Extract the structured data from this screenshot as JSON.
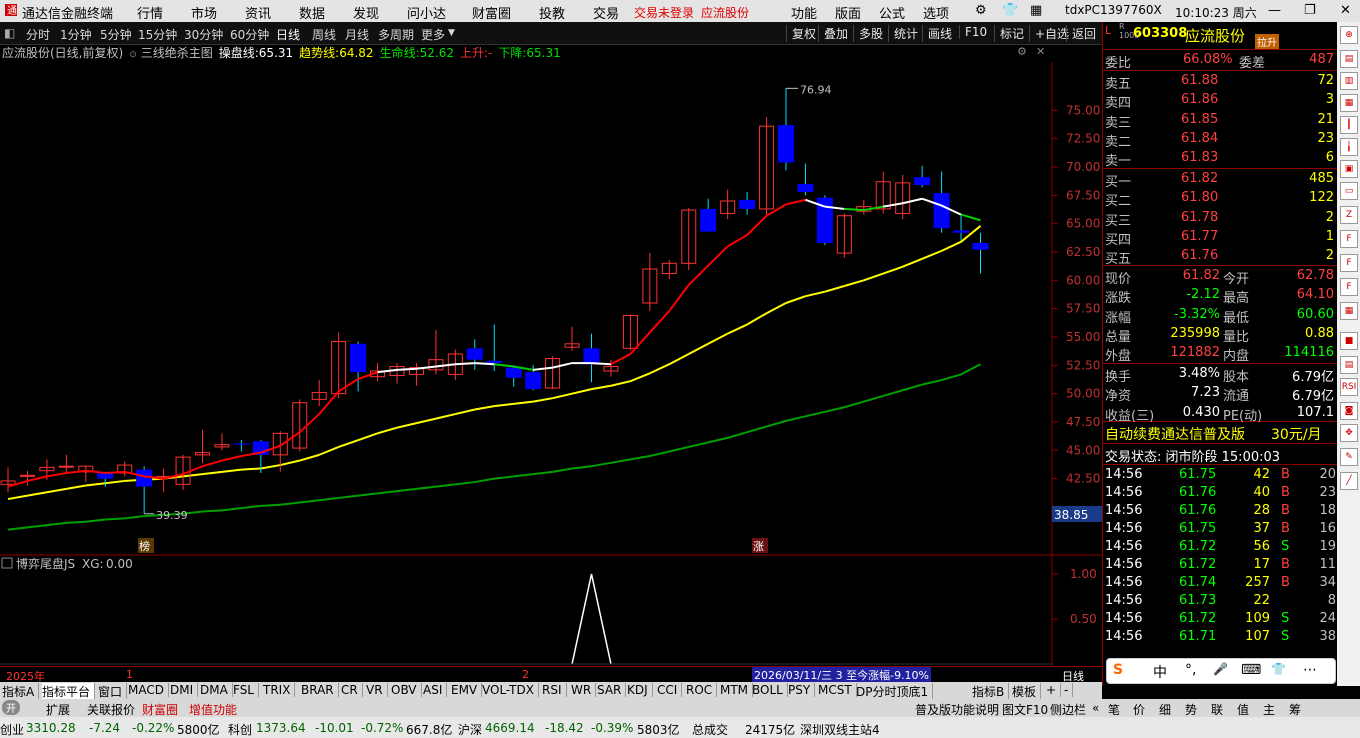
{
  "menubar": {
    "app_title": "通达信金融终端",
    "menus": [
      "行情",
      "市场",
      "资讯",
      "数据",
      "发现",
      "问小达",
      "财富圈",
      "投教",
      "交易"
    ],
    "trade_status": "交易未登录",
    "stock_link": "应流股份",
    "right_menus": [
      "功能",
      "版面",
      "公式",
      "选项"
    ],
    "machine": "tdxPC1397760X",
    "clock": "10:10:23 周六"
  },
  "toolbar": {
    "periods": [
      "分时",
      "1分钟",
      "5分钟",
      "15分钟",
      "30分钟",
      "60分钟",
      "日线",
      "周线",
      "月线",
      "多周期",
      "更多"
    ],
    "selected_period": "日线",
    "actions": [
      "复权",
      "叠加",
      "多股",
      "统计",
      "画线",
      "F10",
      "标记",
      "+自选",
      "返回"
    ]
  },
  "indicator_bar": {
    "title": "应流股份(日线,前复权)",
    "formula": "三线绝杀主图",
    "op_label": "操盘线:",
    "op_value": "65.31",
    "trend_label": "趋势线:",
    "trend_value": "64.82",
    "life_label": "生命线:",
    "life_value": "52.62",
    "up_label": "上升:",
    "up_value": "-",
    "down_label": "下降:",
    "down_value": "65.31"
  },
  "chart_data": {
    "type": "candlestick",
    "y_ticks": [
      "75.00",
      "72.50",
      "70.00",
      "67.50",
      "65.00",
      "62.50",
      "60.00",
      "57.50",
      "55.00",
      "52.50",
      "50.00",
      "47.50",
      "45.00",
      "42.50"
    ],
    "ylim": [
      38.5,
      77.5
    ],
    "annotations": {
      "high": "76.94",
      "low": "39.39",
      "current_tag": "38.85",
      "marker1": "榜",
      "marker2": "涨"
    },
    "candles": [
      {
        "o": 42.0,
        "h": 43.5,
        "l": 41.3,
        "c": 42.3
      },
      {
        "o": 42.7,
        "h": 43.2,
        "l": 41.9,
        "c": 42.8
      },
      {
        "o": 43.2,
        "h": 44.2,
        "l": 42.4,
        "c": 43.5
      },
      {
        "o": 43.6,
        "h": 44.6,
        "l": 43.0,
        "c": 43.6
      },
      {
        "o": 43.1,
        "h": 43.6,
        "l": 42.2,
        "c": 43.6
      },
      {
        "o": 43.0,
        "h": 43.1,
        "l": 41.8,
        "c": 42.5
      },
      {
        "o": 43.0,
        "h": 44.0,
        "l": 42.7,
        "c": 43.7
      },
      {
        "o": 43.3,
        "h": 43.6,
        "l": 39.4,
        "c": 41.8
      },
      {
        "o": 42.6,
        "h": 43.4,
        "l": 41.3,
        "c": 42.7
      },
      {
        "o": 42.0,
        "h": 44.6,
        "l": 41.5,
        "c": 44.4
      },
      {
        "o": 44.6,
        "h": 46.8,
        "l": 43.9,
        "c": 44.8
      },
      {
        "o": 45.3,
        "h": 46.5,
        "l": 45.0,
        "c": 45.5
      },
      {
        "o": 45.6,
        "h": 45.9,
        "l": 44.9,
        "c": 45.5
      },
      {
        "o": 45.8,
        "h": 45.9,
        "l": 43.0,
        "c": 44.6
      },
      {
        "o": 44.6,
        "h": 46.7,
        "l": 43.1,
        "c": 46.5
      },
      {
        "o": 45.2,
        "h": 49.5,
        "l": 44.9,
        "c": 49.2
      },
      {
        "o": 49.5,
        "h": 51.2,
        "l": 48.9,
        "c": 50.1
      },
      {
        "o": 50.0,
        "h": 55.4,
        "l": 49.6,
        "c": 54.6
      },
      {
        "o": 54.4,
        "h": 54.6,
        "l": 50.2,
        "c": 51.9
      },
      {
        "o": 51.5,
        "h": 52.7,
        "l": 51.1,
        "c": 52.0
      },
      {
        "o": 51.6,
        "h": 52.7,
        "l": 50.9,
        "c": 52.4
      },
      {
        "o": 51.7,
        "h": 52.7,
        "l": 50.7,
        "c": 52.3
      },
      {
        "o": 52.1,
        "h": 55.6,
        "l": 51.7,
        "c": 53.0
      },
      {
        "o": 51.7,
        "h": 53.9,
        "l": 51.2,
        "c": 53.5
      },
      {
        "o": 54.0,
        "h": 54.8,
        "l": 52.1,
        "c": 53.0
      },
      {
        "o": 52.9,
        "h": 56.1,
        "l": 52.0,
        "c": 52.7
      },
      {
        "o": 52.3,
        "h": 52.5,
        "l": 50.6,
        "c": 51.4
      },
      {
        "o": 51.9,
        "h": 52.5,
        "l": 50.3,
        "c": 50.4
      },
      {
        "o": 50.5,
        "h": 53.3,
        "l": 50.4,
        "c": 53.1
      },
      {
        "o": 54.1,
        "h": 55.9,
        "l": 53.8,
        "c": 54.4
      },
      {
        "o": 54.0,
        "h": 55.3,
        "l": 51.0,
        "c": 52.6
      },
      {
        "o": 52.0,
        "h": 53.0,
        "l": 51.5,
        "c": 52.4
      },
      {
        "o": 54.0,
        "h": 57.0,
        "l": 53.8,
        "c": 56.9
      },
      {
        "o": 58.0,
        "h": 62.4,
        "l": 57.3,
        "c": 61.0
      },
      {
        "o": 60.6,
        "h": 61.8,
        "l": 60.1,
        "c": 61.5
      },
      {
        "o": 61.5,
        "h": 66.4,
        "l": 60.9,
        "c": 66.2
      },
      {
        "o": 66.3,
        "h": 67.2,
        "l": 64.3,
        "c": 64.3
      },
      {
        "o": 65.9,
        "h": 68.0,
        "l": 65.4,
        "c": 67.0
      },
      {
        "o": 67.1,
        "h": 67.8,
        "l": 65.8,
        "c": 66.3
      },
      {
        "o": 66.3,
        "h": 74.4,
        "l": 65.8,
        "c": 73.6
      },
      {
        "o": 73.7,
        "h": 76.94,
        "l": 69.7,
        "c": 70.4
      },
      {
        "o": 68.5,
        "h": 70.3,
        "l": 67.5,
        "c": 67.8
      },
      {
        "o": 67.3,
        "h": 67.5,
        "l": 63.1,
        "c": 63.3
      },
      {
        "o": 62.4,
        "h": 65.9,
        "l": 62.0,
        "c": 65.7
      },
      {
        "o": 66.1,
        "h": 67.1,
        "l": 65.8,
        "c": 66.5
      },
      {
        "o": 66.3,
        "h": 69.6,
        "l": 65.9,
        "c": 68.7
      },
      {
        "o": 65.9,
        "h": 69.3,
        "l": 65.4,
        "c": 68.6
      },
      {
        "o": 69.1,
        "h": 70.1,
        "l": 68.2,
        "c": 68.4
      },
      {
        "o": 67.7,
        "h": 69.6,
        "l": 64.2,
        "c": 64.6
      },
      {
        "o": 64.4,
        "h": 65.9,
        "l": 63.5,
        "c": 64.2
      },
      {
        "o": 63.3,
        "h": 64.2,
        "l": 60.6,
        "c": 62.7
      }
    ],
    "op_line": [
      41.8,
      42.3,
      42.7,
      43.0,
      43.2,
      43.0,
      43.1,
      42.7,
      42.5,
      42.9,
      43.6,
      44.1,
      44.5,
      44.8,
      45.4,
      46.6,
      48.2,
      50.2,
      51.3,
      51.9,
      52.1,
      52.2,
      52.4,
      52.6,
      52.7,
      52.6,
      52.4,
      52.1,
      52.3,
      52.7,
      52.7,
      52.6,
      53.5,
      55.4,
      57.3,
      59.6,
      61.3,
      63.0,
      64.0,
      65.7,
      66.7,
      67.1,
      66.5,
      66.3,
      66.2,
      66.5,
      66.8,
      67.2,
      66.6,
      65.8,
      65.3
    ],
    "op_colors": [
      "r",
      "r",
      "r",
      "r",
      "r",
      "r",
      "r",
      "r",
      "r",
      "r",
      "r",
      "r",
      "r",
      "r",
      "r",
      "r",
      "r",
      "r",
      "r",
      "r",
      "w",
      "w",
      "w",
      "w",
      "w",
      "w",
      "g",
      "g",
      "w",
      "w",
      "w",
      "w",
      "r",
      "r",
      "r",
      "r",
      "r",
      "r",
      "r",
      "r",
      "r",
      "r",
      "w",
      "w",
      "g",
      "g",
      "w",
      "w",
      "w",
      "w",
      "g"
    ],
    "trend_line": [
      40.7,
      41.0,
      41.3,
      41.6,
      41.9,
      42.1,
      42.3,
      42.4,
      42.5,
      42.7,
      42.9,
      43.1,
      43.3,
      43.4,
      43.7,
      44.1,
      44.6,
      45.3,
      45.9,
      46.5,
      47.0,
      47.4,
      47.8,
      48.2,
      48.6,
      48.9,
      49.1,
      49.3,
      49.6,
      50.0,
      50.4,
      50.7,
      51.1,
      51.8,
      52.6,
      53.5,
      54.4,
      55.3,
      56.1,
      57.1,
      58.0,
      58.6,
      59.0,
      59.5,
      60.0,
      60.6,
      61.2,
      61.9,
      62.6,
      63.4,
      64.8
    ],
    "life_line": [
      38.0,
      38.2,
      38.4,
      38.6,
      38.7,
      38.9,
      39.0,
      39.2,
      39.3,
      39.4,
      39.6,
      39.7,
      39.9,
      40.1,
      40.2,
      40.4,
      40.6,
      40.8,
      41.0,
      41.2,
      41.4,
      41.6,
      41.8,
      42.0,
      42.2,
      42.5,
      42.7,
      42.9,
      43.1,
      43.4,
      43.6,
      43.9,
      44.2,
      44.5,
      44.9,
      45.3,
      45.7,
      46.1,
      46.6,
      47.1,
      47.6,
      48.0,
      48.4,
      48.8,
      49.3,
      49.8,
      50.3,
      50.8,
      51.2,
      51.7,
      52.6
    ]
  },
  "sub_chart": {
    "title": "博弈尾盘JS",
    "xg_label": "XG:",
    "xg_value": "0.00",
    "y_ticks": [
      "1.00",
      "0.50"
    ],
    "signal_index": 30
  },
  "axis_bar": {
    "year": "2025年",
    "m1": "1",
    "m2": "2",
    "range_text": "2026/03/11/三 3 至今涨幅-9.10%",
    "right": "日线"
  },
  "quote": {
    "code": "603308",
    "name": "应流股份",
    "tag": "拉升",
    "wei_bi_label": "委比",
    "wei_bi": "66.08%",
    "wei_cha_label": "委差",
    "wei_cha": "487",
    "asks": [
      {
        "label": "卖五",
        "price": "61.88",
        "vol": "72"
      },
      {
        "label": "卖四",
        "price": "61.86",
        "vol": "3"
      },
      {
        "label": "卖三",
        "price": "61.85",
        "vol": "21"
      },
      {
        "label": "卖二",
        "price": "61.84",
        "vol": "23"
      },
      {
        "label": "卖一",
        "price": "61.83",
        "vol": "6"
      }
    ],
    "bids": [
      {
        "label": "买一",
        "price": "61.82",
        "vol": "485"
      },
      {
        "label": "买二",
        "price": "61.80",
        "vol": "122"
      },
      {
        "label": "买三",
        "price": "61.78",
        "vol": "2"
      },
      {
        "label": "买四",
        "price": "61.77",
        "vol": "1"
      },
      {
        "label": "买五",
        "price": "61.76",
        "vol": "2"
      }
    ],
    "stats": [
      {
        "l1": "现价",
        "v1": "61.82",
        "c1": "#ff4040",
        "l2": "今开",
        "v2": "62.78",
        "c2": "#ff4040"
      },
      {
        "l1": "涨跌",
        "v1": "-2.12",
        "c1": "#00ff00",
        "l2": "最高",
        "v2": "64.10",
        "c2": "#ff4040"
      },
      {
        "l1": "涨幅",
        "v1": "-3.32%",
        "c1": "#00ff00",
        "l2": "最低",
        "v2": "60.60",
        "c2": "#00ff00"
      },
      {
        "l1": "总量",
        "v1": "235998",
        "c1": "#ffff00",
        "l2": "量比",
        "v2": "0.88",
        "c2": "#ffff00"
      },
      {
        "l1": "外盘",
        "v1": "121882",
        "c1": "#ff4040",
        "l2": "内盘",
        "v2": "114116",
        "c2": "#00ff00"
      }
    ],
    "fund": [
      {
        "l1": "换手",
        "v1": "3.48%",
        "l2": "股本",
        "v2": "6.79亿"
      },
      {
        "l1": "净资",
        "v1": "7.23",
        "l2": "流通",
        "v2": "6.79亿"
      },
      {
        "l1": "收益(三)",
        "v1": "0.430",
        "l2": "PE(动)",
        "v2": "107.1"
      }
    ],
    "ad_text": "自动续费通达信普及版",
    "ad_price": "30元/月",
    "trade_status": "交易状态: 闭市阶段 15:00:03",
    "ticks": [
      {
        "t": "14:56",
        "p": "61.75",
        "v": "42",
        "s": "B",
        "n": "20"
      },
      {
        "t": "14:56",
        "p": "61.76",
        "v": "40",
        "s": "B",
        "n": "23"
      },
      {
        "t": "14:56",
        "p": "61.76",
        "v": "28",
        "s": "B",
        "n": "18"
      },
      {
        "t": "14:56",
        "p": "61.75",
        "v": "37",
        "s": "B",
        "n": "16"
      },
      {
        "t": "14:56",
        "p": "61.72",
        "v": "56",
        "s": "S",
        "n": "19"
      },
      {
        "t": "14:56",
        "p": "61.72",
        "v": "17",
        "s": "B",
        "n": "11"
      },
      {
        "t": "14:56",
        "p": "61.74",
        "v": "257",
        "s": "B",
        "n": "34"
      },
      {
        "t": "14:56",
        "p": "61.73",
        "v": "22",
        "s": "",
        "n": "8"
      },
      {
        "t": "14:56",
        "p": "61.72",
        "v": "109",
        "s": "S",
        "n": "24"
      },
      {
        "t": "14:56",
        "p": "61.71",
        "v": "107",
        "s": "S",
        "n": "38"
      }
    ]
  },
  "tabs1": [
    "指标A",
    "指标平台",
    "窗口",
    "MACD",
    "DMI",
    "DMA",
    "FSL",
    "TRIX",
    "BRAR",
    "CR",
    "VR",
    "OBV",
    "ASI",
    "EMV",
    "VOL-TDX",
    "RSI",
    "WR",
    "SAR",
    "KDJ",
    "CCI",
    "ROC",
    "MTM",
    "BOLL",
    "PSY",
    "MCST",
    "DP分时顶底1",
    "指标B",
    "模板",
    "+",
    "-"
  ],
  "tabs2": {
    "toggle": "开",
    "items": [
      "扩展",
      "关联报价",
      "财富圈",
      "增值功能"
    ],
    "right": [
      "普及版功能说明",
      "图文F10",
      "侧边栏"
    ],
    "right_tabs": [
      "笔",
      "价",
      "细",
      "势",
      "联",
      "值",
      "主",
      "筹"
    ]
  },
  "statusbar": {
    "idx1_name": "创业",
    "idx1_val": "3310.28",
    "idx1_chg": "-7.24",
    "idx1_pct": "-0.22%",
    "idx1_amt": "5800亿",
    "idx2_name": "科创",
    "idx2_val": "1373.64",
    "idx2_chg": "-10.01",
    "idx2_pct": "-0.72%",
    "idx2_amt": "667.8亿",
    "idx3_name": "沪深",
    "idx3_val": "4669.14",
    "idx3_chg": "-18.42",
    "idx3_pct": "-0.39%",
    "idx3_amt": "5803亿",
    "total_label": "总成交",
    "total_amt": "24175亿",
    "server": "深圳双线主站4"
  },
  "ime": {
    "logo": "S",
    "items": [
      "中",
      "°,",
      "🎤",
      "⌨",
      "👕",
      "⋯"
    ]
  },
  "colors": {
    "up": "#ff3232",
    "down": "#0000ff",
    "op_red": "#ff0000",
    "op_white": "#ffffff",
    "op_green": "#00d000",
    "trend": "#ffff00",
    "life": "#00a000"
  }
}
